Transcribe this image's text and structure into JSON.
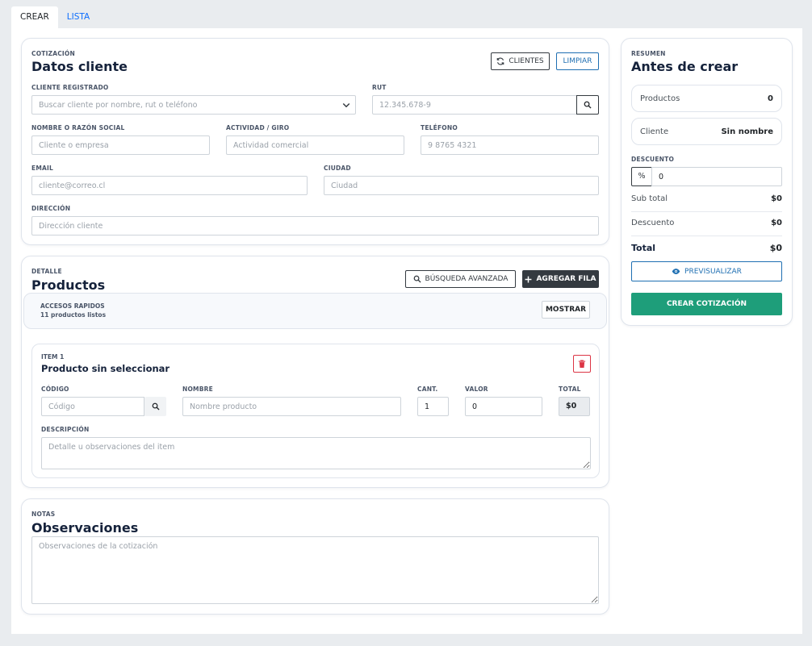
{
  "tabs": [
    {
      "label": "CREAR",
      "active": true
    },
    {
      "label": "LISTA",
      "active": false
    }
  ],
  "cliente": {
    "eyebrow": "COTIZACIÓN",
    "title": "Datos cliente",
    "btn_clientes": "CLIENTES",
    "btn_limpiar": "LIMPIAR",
    "registrado_label": "CLIENTE REGISTRADO",
    "registrado_placeholder": "Buscar cliente por nombre, rut o teléfono",
    "rut_label": "RUT",
    "rut_placeholder": "12.345.678-9",
    "nombre_label": "NOMBRE O RAZÓN SOCIAL",
    "nombre_placeholder": "Cliente o empresa",
    "giro_label": "ACTIVIDAD / GIRO",
    "giro_placeholder": "Actividad comercial",
    "telefono_label": "TELÉFONO",
    "telefono_placeholder": "9 8765 4321",
    "email_label": "EMAIL",
    "email_placeholder": "cliente@correo.cl",
    "ciudad_label": "CIUDAD",
    "ciudad_placeholder": "Ciudad",
    "direccion_label": "DIRECCIÓN",
    "direccion_placeholder": "Dirección cliente"
  },
  "productos": {
    "eyebrow": "DETALLE",
    "title": "Productos",
    "btn_busqueda": "BÚSQUEDA AVANZADA",
    "btn_agregar": "AGREGAR FILA",
    "accesos_title": "ACCESOS RAPIDOS",
    "accesos_sub": "11 productos listos",
    "btn_mostrar": "MOSTRAR",
    "item": {
      "eyebrow": "ITEM 1",
      "title": "Producto sin seleccionar",
      "codigo_label": "CÓDIGO",
      "codigo_placeholder": "Código",
      "nombre_label": "NOMBRE",
      "nombre_placeholder": "Nombre producto",
      "cant_label": "CANT.",
      "cant_value": "1",
      "valor_label": "VALOR",
      "valor_value": "0",
      "total_label": "TOTAL",
      "total_value": "$0",
      "descripcion_label": "DESCRIPCIÓN",
      "descripcion_placeholder": "Detalle u observaciones del item"
    }
  },
  "notas": {
    "eyebrow": "NOTAS",
    "title": "Observaciones",
    "placeholder": "Observaciones de la cotización"
  },
  "resumen": {
    "eyebrow": "RESUMEN",
    "title": "Antes de crear",
    "productos_label": "Productos",
    "productos_value": "0",
    "cliente_label": "Cliente",
    "cliente_value": "Sin nombre",
    "descuento_label": "DESCUENTO",
    "descuento_unit": "%",
    "descuento_value": "0",
    "subtotal_label": "Sub total",
    "subtotal_value": "$0",
    "descuento_row_label": "Descuento",
    "descuento_row_value": "$0",
    "total_label": "Total",
    "total_value": "$0",
    "btn_previsualizar": "PREVISUALIZAR",
    "btn_crear": "CREAR COTIZACIÓN"
  },
  "colors": {
    "accent_blue": "#1f6fb2",
    "dark": "#343a40",
    "green": "#1e9e7a",
    "danger": "#dc3545"
  }
}
